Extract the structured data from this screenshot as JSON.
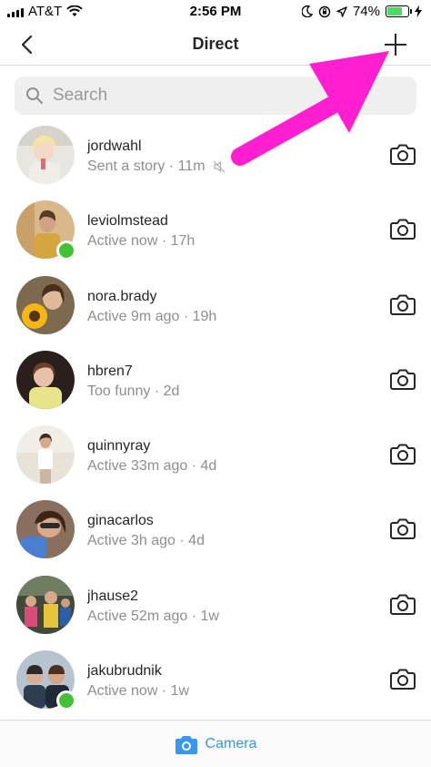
{
  "status_bar": {
    "carrier": "AT&T",
    "time": "2:56 PM",
    "battery_percent": "74%",
    "battery_level": 0.74,
    "icons": [
      "signal-icon",
      "wifi-icon",
      "moon-icon",
      "lock-rotation-icon",
      "location-icon",
      "battery-icon",
      "charging-icon"
    ]
  },
  "header": {
    "title": "Direct",
    "back_icon": "chevron-left-icon",
    "new_message_icon": "plus-icon"
  },
  "search": {
    "placeholder": "Search",
    "value": "",
    "icon": "search-icon"
  },
  "threads": [
    {
      "username": "jordwahl",
      "status": "Sent a story · 11m",
      "muted": true,
      "active": false
    },
    {
      "username": "leviolmstead",
      "status": "Active now · 17h",
      "muted": false,
      "active": true
    },
    {
      "username": "nora.brady",
      "status": "Active 9m ago · 19h",
      "muted": false,
      "active": false
    },
    {
      "username": "hbren7",
      "status": "Too funny · 2d",
      "muted": false,
      "active": false
    },
    {
      "username": "quinnyray",
      "status": "Active 33m ago · 4d",
      "muted": false,
      "active": false
    },
    {
      "username": "ginacarlos",
      "status": "Active 3h ago · 4d",
      "muted": false,
      "active": false
    },
    {
      "username": "jhause2",
      "status": "Active 52m ago · 1w",
      "muted": false,
      "active": false
    },
    {
      "username": "jakubrudnik",
      "status": "Active now · 1w",
      "muted": false,
      "active": true
    }
  ],
  "bottom_bar": {
    "label": "Camera",
    "icon": "camera-icon"
  },
  "colors": {
    "accent": "#3897f0",
    "active_dot": "#44c235",
    "annotation_arrow": "#ff1fd1",
    "battery": "#4cd964"
  }
}
